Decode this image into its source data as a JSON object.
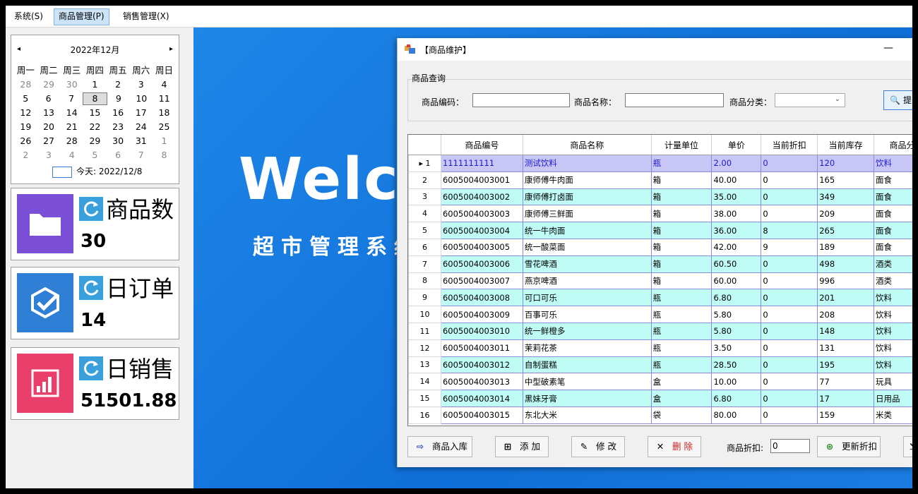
{
  "menu": [
    {
      "label": "系统(S)",
      "active": false
    },
    {
      "label": "商品管理(P)",
      "active": true
    },
    {
      "label": "销售管理(X)",
      "active": false
    }
  ],
  "calendar": {
    "title": "2022年12月",
    "prev": "◂",
    "next": "▸",
    "weekdays": [
      "周一",
      "周二",
      "周三",
      "周四",
      "周五",
      "周六",
      "周日"
    ],
    "weeks": [
      [
        "28",
        "29",
        "30",
        "1",
        "2",
        "3",
        "4"
      ],
      [
        "5",
        "6",
        "7",
        "8",
        "9",
        "10",
        "11"
      ],
      [
        "12",
        "13",
        "14",
        "15",
        "16",
        "17",
        "18"
      ],
      [
        "19",
        "20",
        "21",
        "22",
        "23",
        "24",
        "25"
      ],
      [
        "26",
        "27",
        "28",
        "29",
        "30",
        "31",
        "1"
      ],
      [
        "2",
        "3",
        "4",
        "5",
        "6",
        "7",
        "8"
      ]
    ],
    "selected": "8",
    "today_label": "今天: 2022/12/8"
  },
  "stats": [
    {
      "label": "商品数",
      "value": "30",
      "icon": "folder-icon",
      "color": "#7b4fd6"
    },
    {
      "label": "日订单",
      "value": "14",
      "icon": "check-badge-icon",
      "color": "#2f7fd6"
    },
    {
      "label": "日销售",
      "value": "51501.88",
      "icon": "bar-chart-icon",
      "color": "#ea3f6a"
    }
  ],
  "welcome": {
    "title": "Welco",
    "subtitle": "超市管理系统"
  },
  "dialog": {
    "title": "【商品维护】",
    "minimize": "—",
    "group_title": "商品查询",
    "code_label": "商品编码：",
    "name_label": "商品名称：",
    "category_label": "商品分类：",
    "query_button": "提",
    "columns": [
      "商品编号",
      "商品名称",
      "计量单位",
      "单价",
      "当前折扣",
      "当前库存",
      "商品分"
    ],
    "rows": [
      [
        "1",
        "1111111111",
        "测试饮料",
        "瓶",
        "2.00",
        "0",
        "120",
        "饮料"
      ],
      [
        "2",
        "6005004003001",
        "康师傅牛肉面",
        "箱",
        "40.00",
        "0",
        "165",
        "面食"
      ],
      [
        "3",
        "6005004003002",
        "康师傅打卤面",
        "箱",
        "35.00",
        "0",
        "349",
        "面食"
      ],
      [
        "4",
        "6005004003003",
        "康师傅三鲜面",
        "箱",
        "38.00",
        "0",
        "209",
        "面食"
      ],
      [
        "5",
        "6005004003004",
        "统一牛肉面",
        "箱",
        "36.00",
        "8",
        "265",
        "面食"
      ],
      [
        "6",
        "6005004003005",
        "统一酸菜面",
        "箱",
        "42.00",
        "9",
        "189",
        "面食"
      ],
      [
        "7",
        "6005004003006",
        "雪花啤酒",
        "箱",
        "60.50",
        "0",
        "498",
        "酒类"
      ],
      [
        "8",
        "6005004003007",
        "燕京啤酒",
        "箱",
        "60.00",
        "0",
        "996",
        "酒类"
      ],
      [
        "9",
        "6005004003008",
        "可口可乐",
        "瓶",
        "6.80",
        "0",
        "201",
        "饮料"
      ],
      [
        "10",
        "6005004003009",
        "百事可乐",
        "瓶",
        "5.80",
        "0",
        "208",
        "饮料"
      ],
      [
        "11",
        "6005004003010",
        "统一鲜橙多",
        "瓶",
        "5.80",
        "0",
        "148",
        "饮料"
      ],
      [
        "12",
        "6005004003011",
        "茉莉花茶",
        "瓶",
        "3.50",
        "0",
        "131",
        "饮料"
      ],
      [
        "13",
        "6005004003012",
        "自制蛋糕",
        "瓶",
        "28.50",
        "0",
        "195",
        "饮料"
      ],
      [
        "14",
        "6005004003013",
        "中型破素笔",
        "盒",
        "10.00",
        "0",
        "77",
        "玩具"
      ],
      [
        "15",
        "6005004003014",
        "黑妹牙膏",
        "盒",
        "6.80",
        "0",
        "17",
        "日用品"
      ],
      [
        "16",
        "6005004003015",
        "东北大米",
        "袋",
        "80.00",
        "0",
        "159",
        "米类"
      ]
    ],
    "buttons": {
      "stock_in": "商品入库",
      "add": "添 加",
      "edit": "修 改",
      "delete": "删 除",
      "discount_label": "商品折扣:",
      "discount_value": "0",
      "update_discount": "更新折扣"
    }
  }
}
